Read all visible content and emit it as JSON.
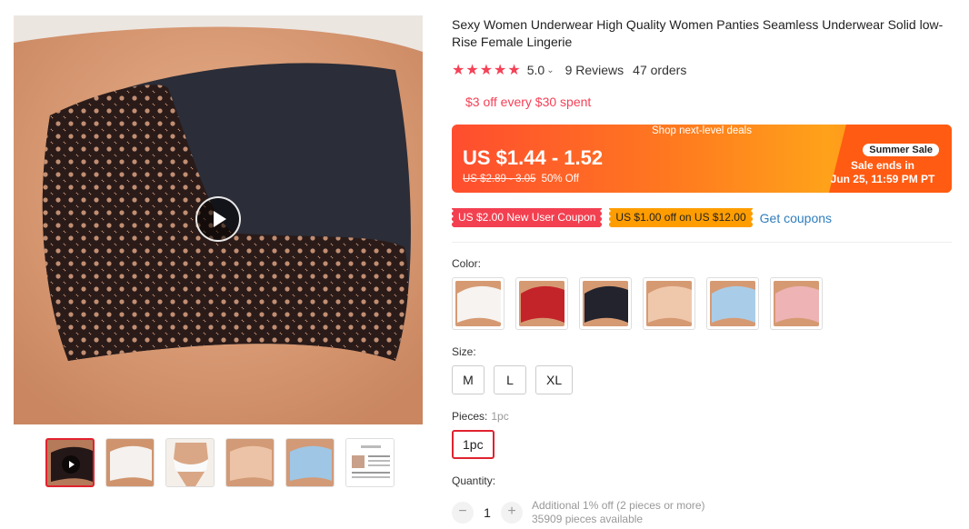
{
  "product": {
    "title": "Sexy Women Underwear High Quality Women Panties Seamless Underwear Solid low-Rise Female Lingerie",
    "stars": "★★★★★",
    "rating": "5.0",
    "reviews": "9 Reviews",
    "orders": "47 orders"
  },
  "promo": {
    "store_discount": "$3 off every $30 spent"
  },
  "deal": {
    "banner": "Shop next-level deals",
    "price": "US $1.44 - 1.52",
    "old_price": "US $2.89 - 3.05",
    "discount": "50% Off",
    "badge": "Summer Sale",
    "ends_label": "Sale ends in",
    "ends_time": "Jun 25, 11:59 PM PT"
  },
  "coupons": {
    "new_user": "US $2.00 New User Coupon",
    "store": "US $1.00 off on US $12.00",
    "get": "Get coupons"
  },
  "options": {
    "color_label": "Color:",
    "colors": [
      "white",
      "red",
      "black",
      "skin",
      "light-blue",
      "pink"
    ],
    "size_label": "Size:",
    "sizes": [
      "M",
      "L",
      "XL"
    ],
    "pieces_label": "Pieces:",
    "pieces_value": "1pc",
    "pieces_option": "1pc",
    "quantity_label": "Quantity:"
  },
  "quantity": {
    "minus": "−",
    "value": "1",
    "plus": "+",
    "additional": "Additional 1% off (2 pieces or more)",
    "available": "35909 pieces available"
  },
  "theme": {
    "accent": "#e0222e",
    "star": "#f54156",
    "link": "#2f7dbd"
  }
}
